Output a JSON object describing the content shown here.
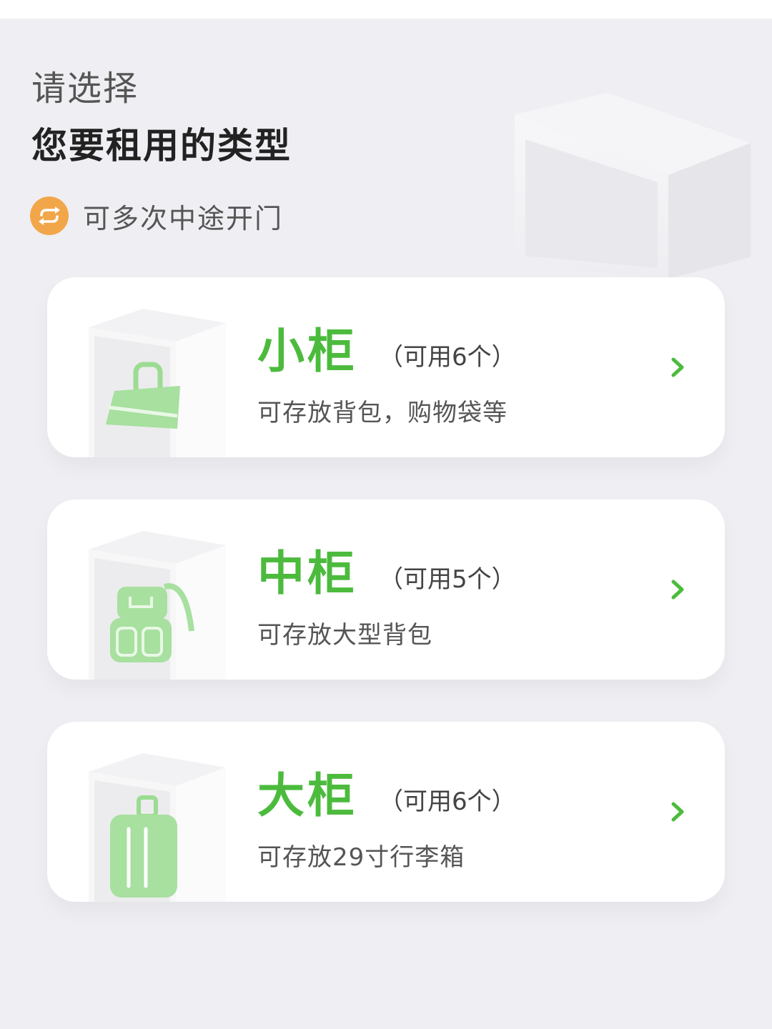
{
  "header": {
    "line1": "请选择",
    "line2": "您要租用的类型"
  },
  "feature": {
    "icon": "refresh-icon",
    "text": "可多次中途开门"
  },
  "cabinets": [
    {
      "name": "小柜",
      "availability": "（可用6个）",
      "description": "可存放背包，购物袋等",
      "icon": "handbag-icon"
    },
    {
      "name": "中柜",
      "availability": "（可用5个）",
      "description": "可存放大型背包",
      "icon": "backpack-icon"
    },
    {
      "name": "大柜",
      "availability": "（可用6个）",
      "description": "可存放29寸行李箱",
      "icon": "suitcase-icon"
    }
  ],
  "colors": {
    "accent_green": "#4cbb3d",
    "feature_orange": "#f2a64a",
    "background": "#efeff3"
  }
}
